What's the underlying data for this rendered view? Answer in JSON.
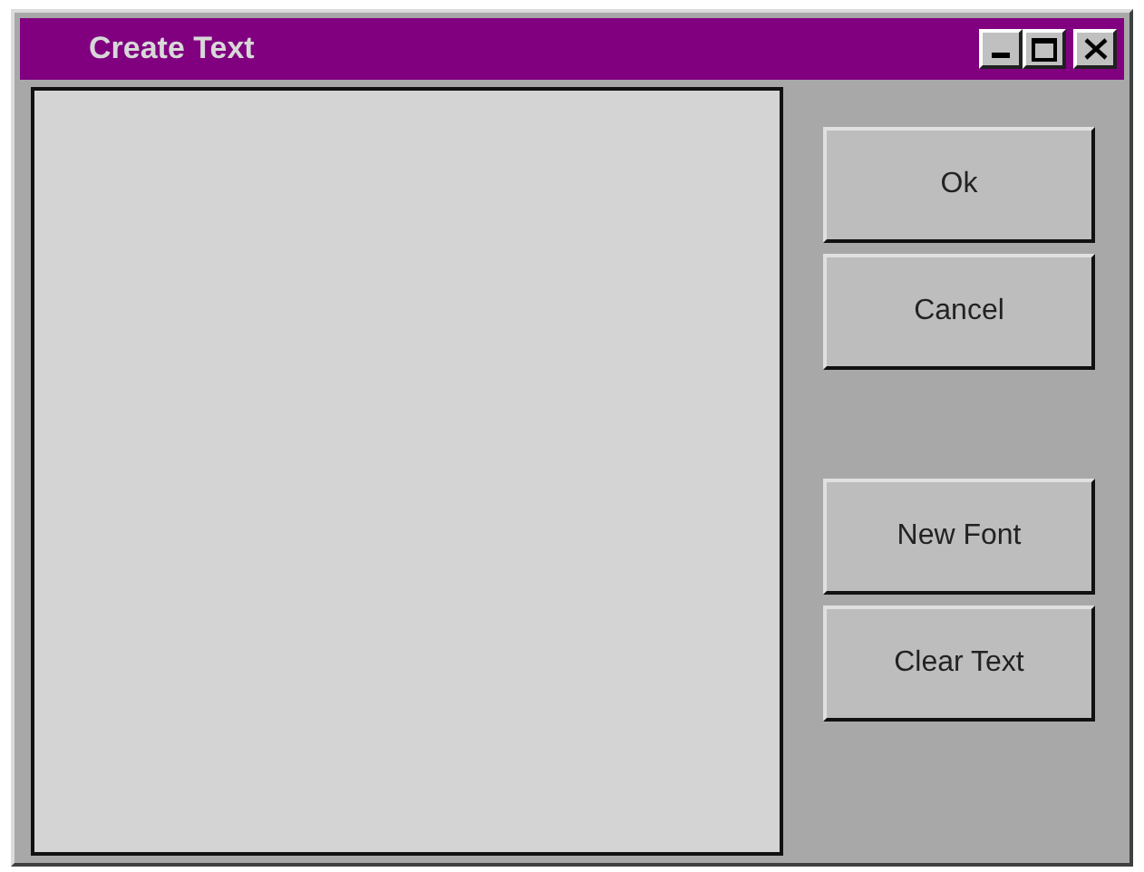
{
  "window": {
    "title": "Create Text"
  },
  "button_groups": [
    {
      "buttons": [
        "Ok",
        "Cancel"
      ]
    },
    {
      "buttons": [
        "New Font",
        "Clear Text"
      ]
    }
  ]
}
